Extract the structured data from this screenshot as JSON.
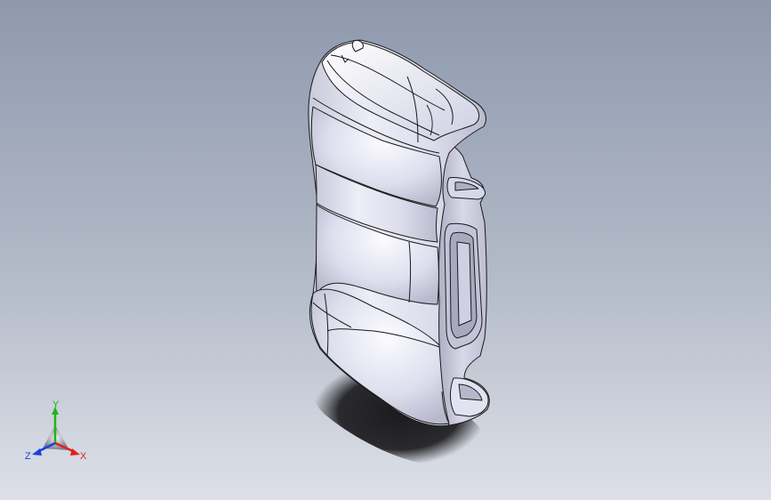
{
  "viewport": {
    "background_top": "#8e99ae",
    "background_bottom": "#dcdfe6"
  },
  "model": {
    "icon": "seat-cushion-model",
    "surface_color": "#e4e5f4",
    "edge_color": "#1a1a1a",
    "shadow_color": "#1f1f22"
  },
  "triad": {
    "x_label": "X",
    "y_label": "Y",
    "z_label": "Z",
    "x_color": "#e0201c",
    "y_color": "#18b818",
    "z_color": "#1a3fe0"
  }
}
